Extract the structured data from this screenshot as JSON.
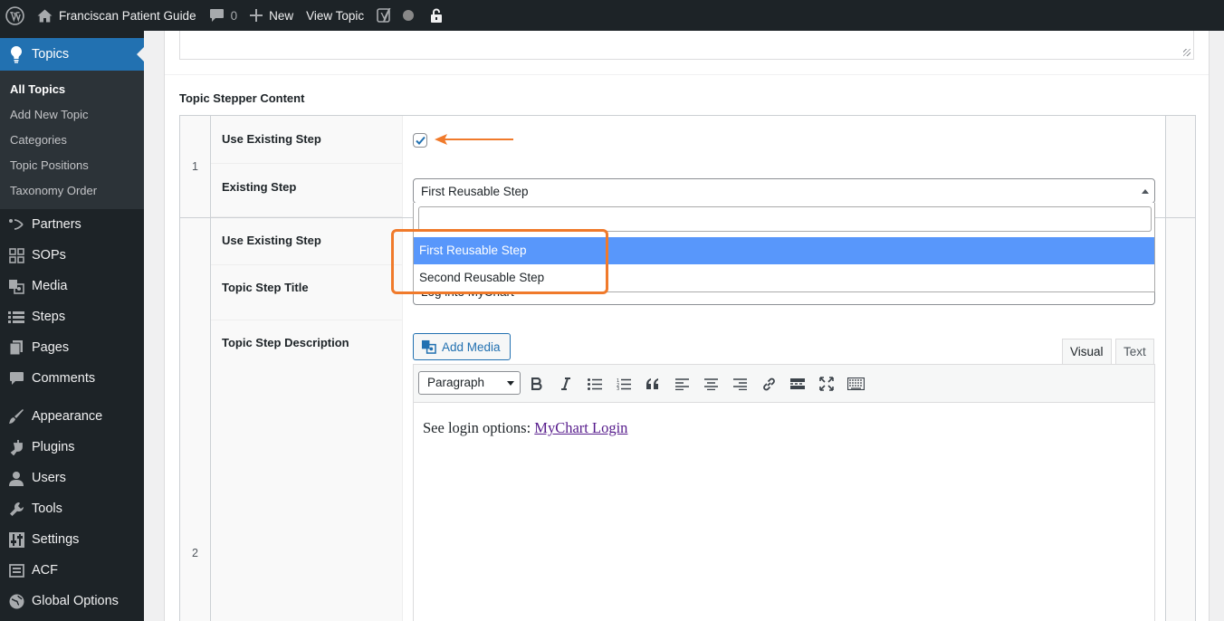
{
  "adminbar": {
    "site_name": "Franciscan Patient Guide",
    "comments_count": "0",
    "new_label": "New",
    "view_label": "View Topic"
  },
  "sidebar": {
    "current": {
      "label": "Topics",
      "icon": "lightbulb-icon"
    },
    "submenu": [
      "All Topics",
      "Add New Topic",
      "Categories",
      "Topic Positions",
      "Taxonomy Order"
    ],
    "items": [
      {
        "label": "Partners",
        "icon": "partners-icon"
      },
      {
        "label": "SOPs",
        "icon": "grid-icon"
      },
      {
        "label": "Media",
        "icon": "media-icon"
      },
      {
        "label": "Steps",
        "icon": "list-icon"
      },
      {
        "label": "Pages",
        "icon": "pages-icon"
      },
      {
        "label": "Comments",
        "icon": "comment-icon"
      },
      {
        "label": "Appearance",
        "icon": "brush-icon"
      },
      {
        "label": "Plugins",
        "icon": "plug-icon"
      },
      {
        "label": "Users",
        "icon": "user-icon"
      },
      {
        "label": "Tools",
        "icon": "wrench-icon"
      },
      {
        "label": "Settings",
        "icon": "sliders-icon"
      },
      {
        "label": "ACF",
        "icon": "acf-icon"
      },
      {
        "label": "Global Options",
        "icon": "globe-icon"
      }
    ]
  },
  "field": {
    "label": "Topic Stepper Content",
    "rows": [
      {
        "number": "1",
        "use_existing_label": "Use Existing Step",
        "use_existing_checked": true,
        "existing_step_label": "Existing Step",
        "existing_step_value": "First Reusable Step",
        "dropdown": {
          "search_value": "",
          "options": [
            "First Reusable Step",
            "Second Reusable Step"
          ],
          "highlighted": "First Reusable Step"
        }
      },
      {
        "number": "2",
        "use_existing_label": "Use Existing Step",
        "title_label": "Topic Step Title",
        "title_value": "Log into MyChart",
        "description_label": "Topic Step Description",
        "add_media_label": "Add Media",
        "tabs": [
          "Visual",
          "Text"
        ],
        "active_tab": "Visual",
        "format_value": "Paragraph",
        "content_prefix": "See login options: ",
        "content_link": "MyChart Login"
      }
    ]
  },
  "colors": {
    "admin_dark": "#1d2327",
    "accent_blue": "#2271b1",
    "highlight_blue": "#5897fb",
    "annotation_orange": "#f07a2b"
  }
}
